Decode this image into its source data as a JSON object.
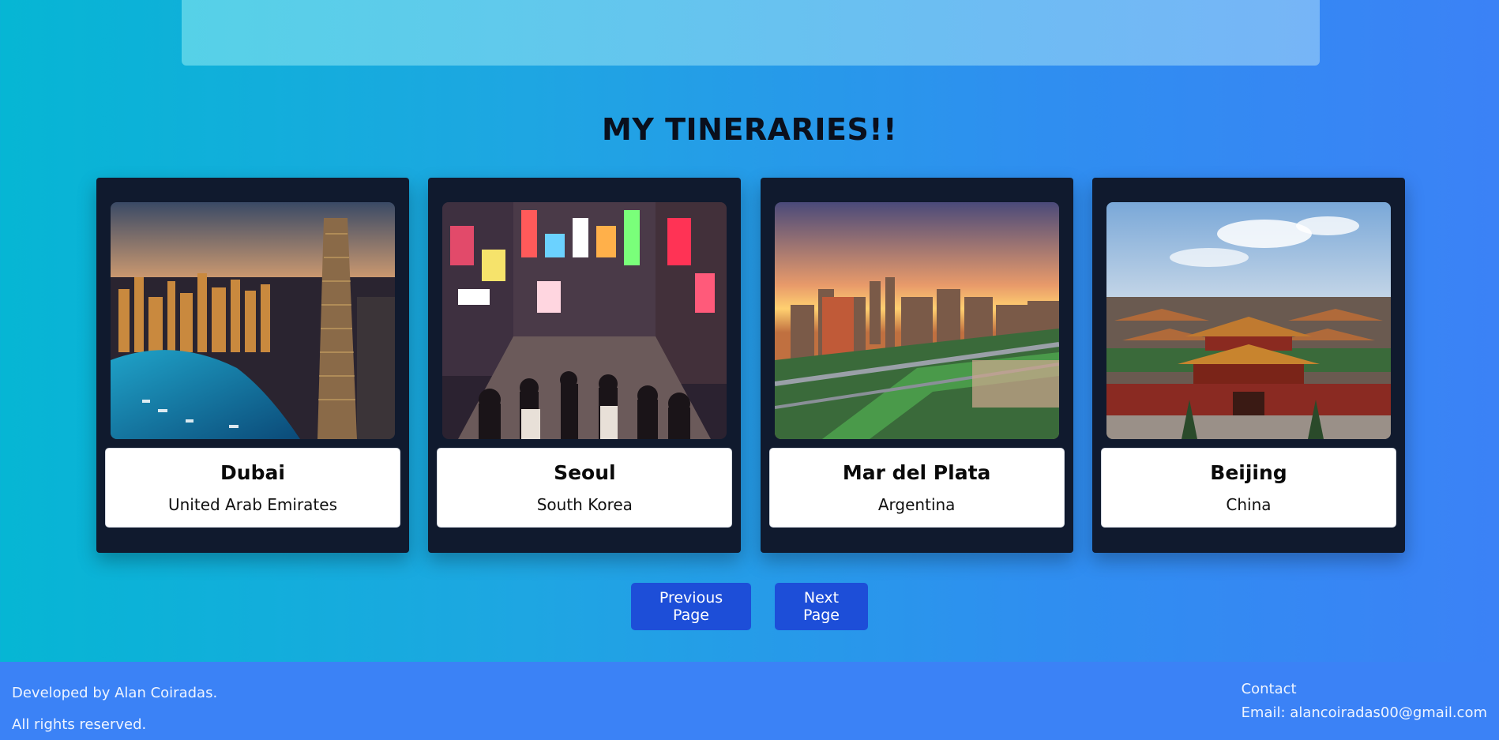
{
  "page": {
    "title": "MY TINERARIES!!"
  },
  "cards": [
    {
      "city": "Dubai",
      "country": "United Arab Emirates",
      "image_icon": "dubai-skyline-image"
    },
    {
      "city": "Seoul",
      "country": "South Korea",
      "image_icon": "seoul-street-image"
    },
    {
      "city": "Mar del Plata",
      "country": "Argentina",
      "image_icon": "mar-del-plata-city-image"
    },
    {
      "city": "Beijing",
      "country": "China",
      "image_icon": "beijing-palace-image"
    }
  ],
  "pagination": {
    "previous_label": "Previous Page",
    "next_label": "Next Page"
  },
  "footer": {
    "developed_by": "Developed by Alan Coiradas.",
    "rights": "All rights reserved.",
    "contact_label": "Contact",
    "email": "Email: alancoiradas00@gmail.com"
  },
  "colors": {
    "background_from": "#06b6d4",
    "background_to": "#3b82f6",
    "card_bg": "#101a2e",
    "button_bg": "#1d4ed8",
    "footer_bg": "#3b82f6"
  }
}
